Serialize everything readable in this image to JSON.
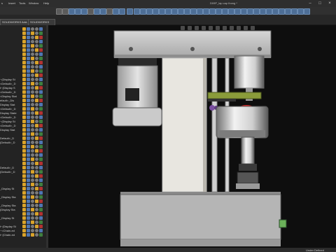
{
  "menu": {
    "items": [
      "s",
      "Insert",
      "Tools",
      "Window",
      "Help"
    ],
    "window_title": "D09P_lap cap thong *"
  },
  "tabs": {
    "addins": "SOLIDWORKS Add-Ins",
    "mbd": "SOLIDWORKS MBD"
  },
  "tree": {
    "rows": [
      "",
      "",
      "",
      "",
      "",
      "",
      "",
      "",
      "",
      "",
      "",
      "",
      "~(Display St",
      "<Default>_D",
      "t~(Display S",
      "<Default>_D",
      "<Display Stat",
      "efault>_Dis",
      "Display Stat",
      "<Default>_D",
      "Display State",
      "<Default>_D",
      "~(Display St",
      "<Default>_D",
      "Display Stat",
      "",
      "Default>_D",
      "(Default>_D",
      "",
      "",
      "",
      "",
      "",
      "Default>_D",
      "(Default>_D",
      "",
      "",
      "",
      "_Display St",
      "",
      "_Display Sta",
      "",
      "_Display Sta",
      "(Display Sta",
      "",
      "_Display St",
      "",
      "t~(Display St",
      "~<Chain-ed",
      "t~(Chain-ed"
    ]
  },
  "status": {
    "text": "Under Defined"
  },
  "colors": {
    "accent": "#4f76b3",
    "folder": "#d9a32b",
    "part_body": "#dedede",
    "gear_green": "#8a9b3a"
  }
}
